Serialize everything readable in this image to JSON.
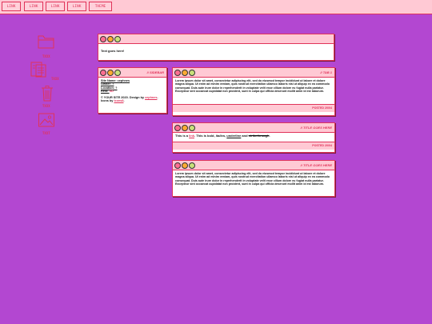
{
  "nav": {
    "links": [
      "LINK",
      "LINK",
      "LINK",
      "LINK"
    ],
    "theme": "THEME"
  },
  "desktop": {
    "icons": [
      {
        "icon": "folder-icon",
        "label": "TXXX"
      },
      {
        "icon": "document-icon",
        "label": "TXXX"
      },
      {
        "icon": "trash-icon",
        "label": "TXXX"
      },
      {
        "icon": "image-icon",
        "label": "TXXT"
      }
    ]
  },
  "windows": {
    "top": {
      "body": "Text goes here!"
    },
    "sidebar": {
      "tag": "// SIDEBAR",
      "site_name": "Site Name: cephnes",
      "owner": "Owner: ?",
      "location": "Location: ?",
      "rest_label": "Rest: ",
      "rest_value": "XD",
      "credit_prefix": "© YOUR SITE 2020. Design by ",
      "credit_author": "cephnes",
      "credit_mid": ". Icons by ",
      "credit_icons": "Icons8",
      "credit_end": "."
    },
    "tab1": {
      "tag": "// TAB 1",
      "body": "Lorem ipsum dolor sit amet, consectetur adipiscing elit, sed do eiusmod tempor incididunt ut labore et dolore magna aliqua. Ut enim ad minim veniam, quis nostrud exercitation ullamco laboris nisi ut aliquip ex ea commodo consequat. Duis aute irure dolor in reprehenderit in voluptate velit esse cillum dolore eu fugiat nulla pariatur. Excepteur sint occaecat cupidatat non proident, sunt in culpa qui officia deserunt mollit anim id est laborum.",
      "footer": "POSTED 20/04"
    },
    "tab2": {
      "tag": "// TITLE GOES HERE",
      "p1": "This is a ",
      "link": "link",
      "p2": ". This is ",
      "bold": "bold",
      "p3": ", ",
      "italic": "italics",
      "p4": ", ",
      "underline": "underline",
      "p5": " and ",
      "strike": "strikethrough",
      "p6": ".",
      "footer": "POSTED 20/04"
    },
    "tab3": {
      "tag": "// TITLE GOES HERE",
      "body": "Lorem ipsum dolor sit amet, consectetur adipiscing elit, sed do eiusmod tempor incididunt ut labore et dolore magna aliqua. Ut enim ad minim veniam, quis nostrud exercitation ullamco laboris nisi ut aliquip ex ea commodo consequat. Duis aute irure dolor in reprehenderit in voluptate velit esse cillum dolore eu fugiat nulla pariatur. Excepteur sint occaecat cupidatat non proident, sunt in culpa qui officia deserunt mollit anim id est laborum."
    }
  },
  "colors": {
    "background": "#b347d1",
    "accent": "#e0335a",
    "panel": "#ffc9d4"
  }
}
